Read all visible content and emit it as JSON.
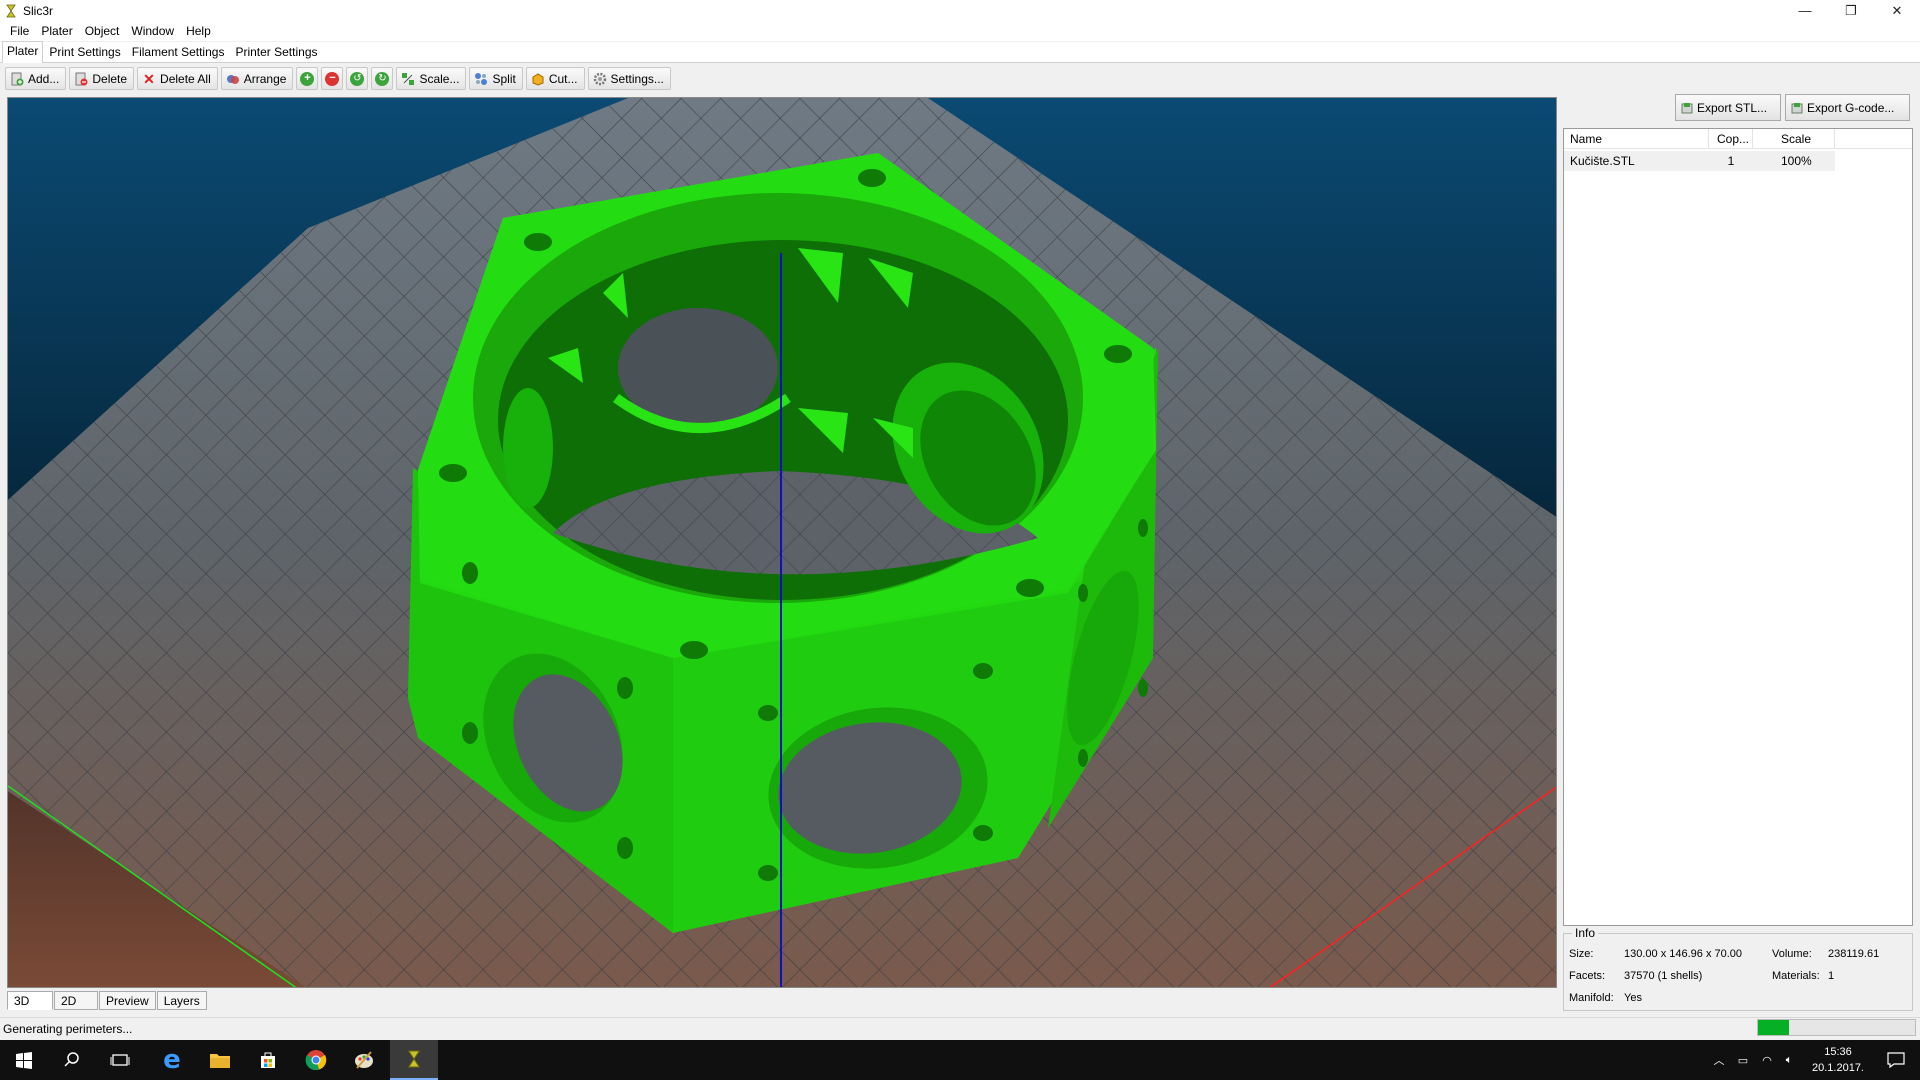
{
  "window": {
    "title": "Slic3r",
    "minimize_glyph": "—",
    "restore_glyph": "❐",
    "close_glyph": "✕"
  },
  "menu": [
    "File",
    "Plater",
    "Object",
    "Window",
    "Help"
  ],
  "tabs": [
    "Plater",
    "Print Settings",
    "Filament Settings",
    "Printer Settings"
  ],
  "toolbar": {
    "add": "Add...",
    "delete": "Delete",
    "delete_all": "Delete All",
    "arrange": "Arrange",
    "scale": "Scale...",
    "split": "Split",
    "cut": "Cut...",
    "settings": "Settings...",
    "icons": [
      "add-icon",
      "delete-icon",
      "delete-all-icon",
      "arrange-icon",
      "increase-copies-icon",
      "decrease-copies-icon",
      "rotate-left-icon",
      "rotate-right-icon",
      "scale-icon",
      "split-icon",
      "cut-icon",
      "settings-icon"
    ]
  },
  "view_tabs": [
    "3D",
    "2D",
    "Preview",
    "Layers"
  ],
  "export": {
    "stl": "Export STL...",
    "gcode": "Export G-code..."
  },
  "object_list": {
    "columns": [
      "Name",
      "Cop...",
      "Scale"
    ],
    "rows": [
      {
        "name": "Kučište.STL",
        "copies": "1",
        "scale": "100%"
      }
    ]
  },
  "info": {
    "legend": "Info",
    "size_label": "Size:",
    "size_value": "130.00 x 146.96 x 70.00",
    "volume_label": "Volume:",
    "volume_value": "238119.61",
    "facets_label": "Facets:",
    "facets_value": "37570 (1 shells)",
    "materials_label": "Materials:",
    "materials_value": "1",
    "manifold_label": "Manifold:",
    "manifold_value": "Yes"
  },
  "status": {
    "text": "Generating perimeters...",
    "progress": 0.2
  },
  "taskbar": {
    "time": "15:36",
    "date": "20.1.2017."
  },
  "colors": {
    "model": "#22dd11",
    "bed_top": "#0a4a72",
    "bed_bottom": "#7a4a38",
    "x_axis": "#ff2020",
    "y_axis": "#20e020",
    "z_axis": "#1010c0",
    "progress": "#06b025"
  }
}
